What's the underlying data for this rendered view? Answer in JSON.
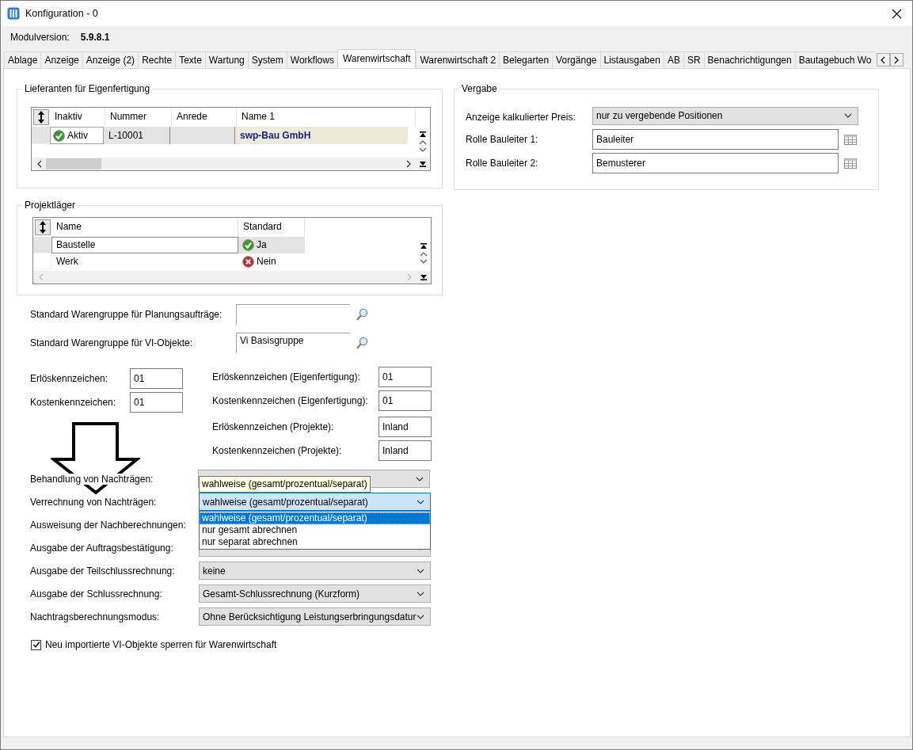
{
  "window": {
    "title": "Konfiguration - 0"
  },
  "module_version": {
    "label": "Modulversion:",
    "value": "5.9.8.1"
  },
  "tabs": [
    {
      "label": "Ablage",
      "selected": false
    },
    {
      "label": "Anzeige",
      "selected": false
    },
    {
      "label": "Anzeige (2)",
      "selected": false
    },
    {
      "label": "Rechte",
      "selected": false
    },
    {
      "label": "Texte",
      "selected": false
    },
    {
      "label": "Wartung",
      "selected": false
    },
    {
      "label": "System",
      "selected": false
    },
    {
      "label": "Workflows",
      "selected": false
    },
    {
      "label": "Warenwirtschaft",
      "selected": true
    },
    {
      "label": "Warenwirtschaft 2",
      "selected": false
    },
    {
      "label": "Belegarten",
      "selected": false
    },
    {
      "label": "Vorgänge",
      "selected": false
    },
    {
      "label": "Listausgaben",
      "selected": false
    },
    {
      "label": "AB",
      "selected": false
    },
    {
      "label": "SR",
      "selected": false
    },
    {
      "label": "Benachrichtigungen",
      "selected": false
    },
    {
      "label": "Bautagebuch Wo",
      "selected": false
    }
  ],
  "lieferanten": {
    "title": "Lieferanten für Eigenfertigung",
    "columns": [
      "Inaktiv",
      "Nummer",
      "Anrede",
      "Name 1"
    ],
    "rows": [
      {
        "selected": true,
        "active": true,
        "status": "Aktiv",
        "nummer": "L-10001",
        "name": "swp-Bau GmbH"
      }
    ]
  },
  "projektlaeger": {
    "title": "Projektläger",
    "columns": [
      "Name",
      "Standard"
    ],
    "rows": [
      {
        "selected": true,
        "name": "Baustelle",
        "is_default": true,
        "standard": "Ja"
      },
      {
        "selected": false,
        "name": "Werk",
        "is_default": false,
        "standard": "Nein"
      }
    ]
  },
  "vergabe": {
    "title": "Vergabe",
    "fields": [
      {
        "kind": "select",
        "label": "Anzeige kalkulierter Preis:",
        "value": "nur zu vergebende Positionen"
      },
      {
        "kind": "lookup",
        "label": "Rolle Bauleiter 1:",
        "value": "Bauleiter"
      },
      {
        "kind": "lookup",
        "label": "Rolle Bauleiter 2:",
        "value": "Bemusterer"
      }
    ]
  },
  "warengruppen": [
    {
      "label": "Standard Warengruppe für Planungsaufträge:"
    },
    {
      "label": "Standard Warengruppe für VI-Objekte:",
      "value": "Vi Basisgruppe"
    }
  ],
  "kennzeichen_left": [
    {
      "label": "Erlöskennzeichen:",
      "value": "01"
    },
    {
      "label": "Kostenkennzeichen:",
      "value": "01"
    }
  ],
  "kennzeichen_right": [
    {
      "label": "Erlöskennzeichen (Eigenfertigung):",
      "value": "01"
    },
    {
      "label": "Kostenkennzeichen (Eigenfertigung):",
      "value": "01"
    },
    {
      "label": "Erlöskennzeichen (Projekte):",
      "value": "Inland"
    },
    {
      "label": "Kostenkennzeichen (Projekte):",
      "value": "Inland"
    }
  ],
  "dropdowns": [
    {
      "label": "Behandlung von Nachträgen:",
      "focused": false
    },
    {
      "label": "Verrechnung von Nachträgen:",
      "value": "wahlweise (gesamt/prozentual/separat)",
      "focused": true
    },
    {
      "label": "Ausweisung der Nachberechnungen:"
    },
    {
      "label": "Ausgabe der Auftragsbestätigung:",
      "focused": false
    },
    {
      "label": "Ausgabe der Teilschlussrechnung:",
      "value": "keine",
      "focused": false
    },
    {
      "label": "Ausgabe der Schlussrechnung:",
      "value": "Gesamt-Schlussrechnung (Kurzform)",
      "focused": false
    },
    {
      "label": "Nachtragsberechnungsmodus:",
      "value": "Ohne Berücksichtigung Leistungserbringungsdatur",
      "focused": false
    }
  ],
  "tooltip": "wahlweise (gesamt/prozentual/separat)",
  "dropdown_list": [
    {
      "label": "wahlweise (gesamt/prozentual/separat)",
      "selected": true
    },
    {
      "label": "nur gesamt abrechnen",
      "selected": false
    },
    {
      "label": "nur separat abrechnen",
      "selected": false
    }
  ],
  "checkbox": {
    "label": "Neu importierte VI-Objekte sperren für Warenwirtschaft",
    "checked": true
  }
}
